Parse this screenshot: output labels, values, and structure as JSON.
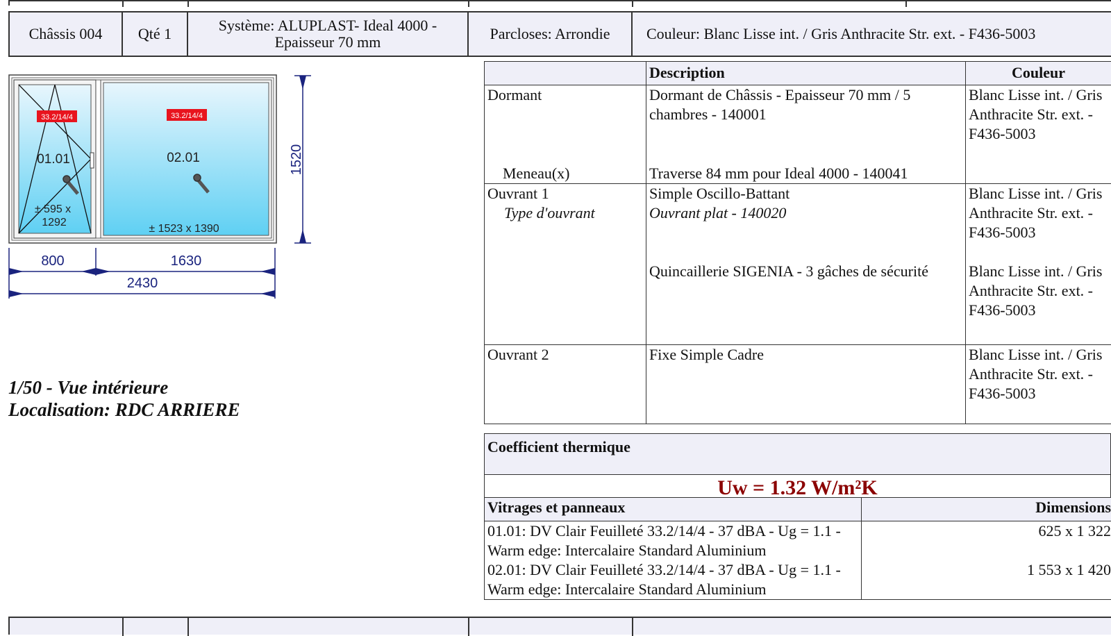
{
  "header": {
    "chassis": "Châssis 004",
    "qty": "Qté 1",
    "systeme_line1": "Système: ALUPLAST- Ideal 4000 -",
    "systeme_line2": "Epaisseur 70 mm",
    "parcloses": "Parcloses: Arrondie",
    "couleur": "Couleur: Blanc Lisse int. / Gris Anthracite Str. ext. - F436-5003"
  },
  "drawing": {
    "sash_left_label": "33.2/14/4",
    "sash_right_label": "33.2/14/4",
    "sash_left_code": "01.01",
    "sash_right_code": "02.01",
    "sash_left_dims_line1": "± 595 x",
    "sash_left_dims_line2": "1292",
    "sash_right_dims": "± 1523 x 1390",
    "height": "1520",
    "width_left": "800",
    "width_right": "1630",
    "width_total": "2430"
  },
  "notes": {
    "scale_view": "1/50 - Vue intérieure",
    "localisation": "Localisation: RDC ARRIERE"
  },
  "components_table": {
    "headers": [
      "",
      "Description",
      "Couleur"
    ],
    "color_text": "Blanc Lisse int. / Gris Anthracite Str. ext. - F436-5003",
    "rows": [
      {
        "label": "Dormant",
        "desc": "Dormant de Châssis - Epaisseur 70 mm / 5 chambres - 140001"
      },
      {
        "label": "Meneau(x)",
        "desc": "Traverse 84 mm pour Ideal 4000 - 140041"
      },
      {
        "label": "Ouvrant 1",
        "desc": "Simple Oscillo-Battant"
      },
      {
        "label": "Type d'ouvrant",
        "desc": "Ouvrant plat - 140020"
      },
      {
        "label": "",
        "desc": "Quincaillerie SIGENIA - 3 gâches de sécurité"
      },
      {
        "label": "Ouvrant 2",
        "desc": "Fixe Simple Cadre"
      }
    ]
  },
  "thermal": {
    "title": "Coefficient thermique",
    "value": "Uw = 1.32 W/m²K"
  },
  "glazing_table": {
    "headers": [
      "Vitrages et panneaux",
      "Dimensions"
    ],
    "rows": [
      {
        "desc": "01.01: DV Clair Feuilleté 33.2/14/4 - 37 dBA - Ug = 1.1 - Warm edge: Intercalaire Standard Aluminium",
        "dims": "625 x 1 322"
      },
      {
        "desc": "02.01: DV Clair Feuilleté 33.2/14/4 - 37 dBA - Ug = 1.1 - Warm edge: Intercalaire Standard Aluminium",
        "dims": "1 553 x 1 420"
      }
    ]
  },
  "colors": {
    "header_bg": "#efeff8",
    "thermal_value": "#8b0000",
    "dimension_text": "#1a237e",
    "glass_top": "#e8f6fd",
    "glass_bottom": "#5fd0f3",
    "label_red": "#e8141e"
  }
}
